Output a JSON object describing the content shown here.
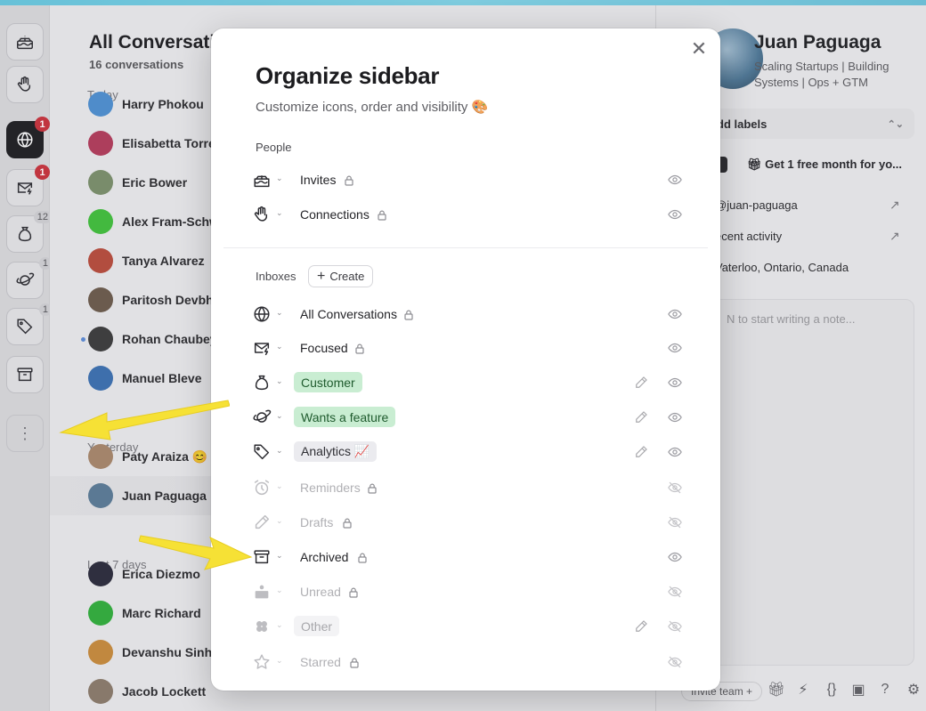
{
  "rail": {
    "badges": {
      "all": "1",
      "focused": "1",
      "customer": "12",
      "feature": "1",
      "analytics": "1"
    }
  },
  "conversations": {
    "title": "All Conversations",
    "count": "16 conversations",
    "groups": [
      "Today",
      "Yesterday",
      "Last 7 days"
    ],
    "rows": [
      {
        "name": "Harry Phokou",
        "color": "#4d8fd1"
      },
      {
        "name": "Elisabetta Torre",
        "color": "#b23a5a"
      },
      {
        "name": "Eric Bower",
        "color": "#7a8f6a"
      },
      {
        "name": "Alex Fram-Schw",
        "color": "#3fbf3a"
      },
      {
        "name": "Tanya Alvarez",
        "color": "#b84a3a"
      },
      {
        "name": "Paritosh Devbh",
        "color": "#6b5a4a"
      },
      {
        "name": "Rohan Chaubey",
        "color": "#3a3a3a"
      },
      {
        "name": "Manuel Bleve",
        "color": "#3a6fb0"
      },
      {
        "name": "Paty Araiza 😊",
        "color": "#a8866a"
      },
      {
        "name": "Juan Paguaga",
        "color": "#5a7a96"
      },
      {
        "name": "Erica Diezmo",
        "color": "#2a2a3a"
      },
      {
        "name": "Marc Richard",
        "color": "#2fae3a"
      },
      {
        "name": "Devanshu Sinha",
        "color": "#c88a3a"
      },
      {
        "name": "Jacob Lockett",
        "color": "#8a7a6a"
      }
    ]
  },
  "profile": {
    "name": "Juan Paguaga",
    "bio": "Scaling Startups | Building Systems | Ops + GTM",
    "labels_placeholder": "dd labels",
    "promo": "Get 1 free month for yo...",
    "handle": "@juan-paguaga",
    "activity": "ecent activity",
    "location": "Vaterloo, Ontario, Canada",
    "note_placeholder": "N to start writing a note...",
    "invite": "Invite team +"
  },
  "modal": {
    "title": "Organize sidebar",
    "subtitle": "Customize icons, order and visibility 🎨",
    "people_heading": "People",
    "inboxes_heading": "Inboxes",
    "create_label": "Create",
    "people": [
      {
        "label": "Invites",
        "icon": "cake-icon"
      },
      {
        "label": "Connections",
        "icon": "hand-icon"
      }
    ],
    "inboxes": [
      {
        "label": "All Conversations",
        "icon": "globe-icon"
      },
      {
        "label": "Focused",
        "icon": "mail-bolt-icon"
      },
      {
        "label": "Customer",
        "icon": "money-bag-icon"
      },
      {
        "label": "Wants a feature",
        "icon": "planet-icon"
      },
      {
        "label": "Analytics 📈",
        "icon": "tag-icon"
      },
      {
        "label": "Reminders",
        "icon": "alarm-icon"
      },
      {
        "label": "Drafts",
        "icon": "pencil-icon"
      },
      {
        "label": "Archived",
        "icon": "archive-icon"
      },
      {
        "label": "Unread",
        "icon": "unread-icon"
      },
      {
        "label": "Other",
        "icon": "clover-icon"
      },
      {
        "label": "Starred",
        "icon": "star-icon"
      }
    ]
  },
  "colors": {
    "accent_green": "#c9edd2",
    "badge_red": "#c8303a",
    "arrow_yellow": "#f6e135"
  }
}
